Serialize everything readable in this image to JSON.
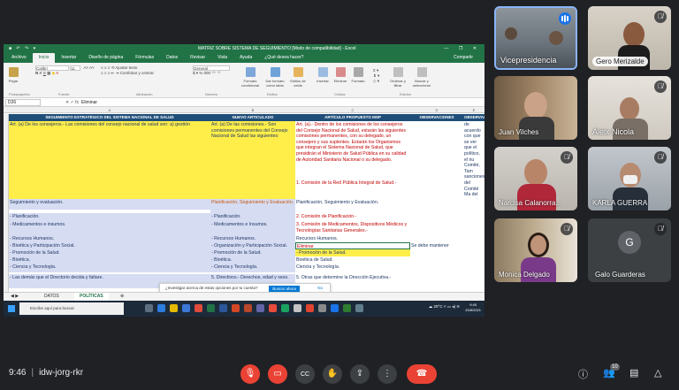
{
  "excel": {
    "title": "MATRIZ SOBRE SISTEMA DE SEGUIMIENTO [Modo de compatibilidad] - Excel",
    "tabs": [
      "Archivo",
      "Inicio",
      "Insertar",
      "Diseño de página",
      "Fórmulas",
      "Datos",
      "Revisar",
      "Vista",
      "Ayuda",
      "¿Qué desea hacer?"
    ],
    "share_label": "Compartir",
    "font_name": "Calibri",
    "font_size": "11",
    "ribbon": {
      "paste": "Pegar",
      "wrap": "Ajustar texto",
      "merge": "Combinar y centrar",
      "number_format": "General",
      "cond_format": "Formato condicional",
      "format_table": "Dar formato como tabla",
      "cell_styles": "Estilos de celda",
      "insert": "Insertar",
      "delete": "Eliminar",
      "format": "Formato",
      "sort_filter": "Ordenar y filtrar",
      "find_select": "Buscar y seleccionar",
      "group_clipboard": "Portapapeles",
      "group_font": "Fuente",
      "group_align": "Alineación",
      "group_number": "Número",
      "group_styles": "Estilos",
      "group_cells": "Celdas",
      "group_edit": "Edición"
    },
    "name_box": "D26",
    "formula_value": "Eliminar",
    "col_headers": [
      "A",
      "B",
      "C",
      "D",
      "E"
    ],
    "headers": {
      "a": "SEGUIMIENTO ESTRATÉGICO DEL SISTEMA NACIONAL DE SALUD",
      "b": "NUEVO ARTICULADO",
      "c": "ARTÍCULO PROPUESTO MSP",
      "d": "OBSERVACIONES",
      "e": "OBSERVAC"
    },
    "rows": {
      "r1_a": "Art. (a) De los consejeros.- Las comisiones del consejo nacional de salud son: a) gestión",
      "r1_b": "Art. (a) De las comisiones.- Son comisiones permanentes del Consejo Nacional de Salud las siguientes:",
      "r1_c": "Art. (a).- Dentro de los comisiones de los consejeros del Consejo Nacional de Salud, estarán las siguientes comisiones permanentes, con su delegado, un consejero y sus suplentes. Estarán los Organismos que integran el Sistema Nacional de Salud, que presidirán el Ministerio de Salud Pública en su calidad de Autoridad Sanitaria Nacional o su delegado.",
      "r1_c2": "1. Comisión de la Red Pública Integral de Salud.-",
      "r1_e": "de acuerdo con que se ver que el político, el nu Comité, Tam sanciones, del Comité Ma del consejo, medicamentos no deben de a lo que en la ley, y se debe ser decidido.",
      "r2_a": "Seguimiento y evaluación.",
      "r2_b": "Planificación, Seguimiento y Evaluación.",
      "r2_c": "Planificación, Seguimiento y Evaluación.",
      "r3_a": "- Planificación.",
      "r3_b": "- Planificación.",
      "r3_c": "2. Comisión de Planificación.-",
      "r4_a": "- Medicamentos e insumos.",
      "r4_b": "- Medicamentos e Insumos.",
      "r4_c": "3. Comisión de Medicamentos, Dispositivos Médicos y Tecnologías Sanitarias Generales.-",
      "r5_a": "- Recursos Humanos.",
      "r5_b": "- Recursos Humanos.",
      "r5_c": "Recursos Humanos.",
      "r6_a": "- Bioética y Participación Social.",
      "r6_b": "- Organización y Participación Social.",
      "r6_c": "Eliminar",
      "r6_d": "Se debe mantener",
      "r7_a": "- Promoción de la Salud.",
      "r7_b": "- Promoción de la Salud.",
      "r7_c": "- Promoción de la Salud.",
      "r8_a": "- Bioética.",
      "r8_b": "- Bioética.",
      "r8_c": "Bioética de Salud.",
      "r9_a": "- Ciencia y Tecnología.",
      "r9_b": "- Ciencia y Tecnología.",
      "r9_c": "Ciencia y Tecnología.",
      "r10_a": "- Las demás que el Directorio decida y faltare.",
      "r10_b": "5. Directivos.- Derechos, edad y sexo.",
      "r10_c": "5. Otras que determine la Dirección Ejecutiva.-"
    },
    "sheets": [
      "DATOS",
      "POLÍTICAS"
    ],
    "active_sheet": "POLÍTICAS",
    "notification": {
      "text": "¿Investigar acerca de estas opciones por tu cuenta?",
      "button": "Buscar ahora",
      "close": "No"
    },
    "taskbar": {
      "search_placeholder": "Escribe aquí para buscar",
      "temperature": "20°C",
      "time": "9:45",
      "date": "23/8/2021"
    }
  },
  "participants": [
    {
      "name": "Vicepresidencia",
      "muted": false,
      "speaking": true
    },
    {
      "name": "Gero Merizalde",
      "muted": true
    },
    {
      "name": "Juan Vilches",
      "muted": false
    },
    {
      "name": "Aleix Nicola",
      "muted": true
    },
    {
      "name": "Narcisa Calanorra...",
      "muted": true
    },
    {
      "name": "KARLA GUERRA",
      "muted": true
    },
    {
      "name": "Monica Delgado",
      "muted": true
    },
    {
      "name": "Galo Guarderas",
      "muted": true,
      "initial": "G"
    }
  ],
  "meeting": {
    "time": "9:46",
    "code": "idw-jorg-rkr",
    "people_count": "10"
  },
  "colors": {
    "excel_green": "#217346",
    "header_blue": "#1f4e79",
    "yellow_row": "#ffee4a",
    "lavender_row": "#d6dcf2",
    "meet_red": "#ea4335",
    "meet_bg": "#202124",
    "speaker_blue": "#1a73e8"
  }
}
